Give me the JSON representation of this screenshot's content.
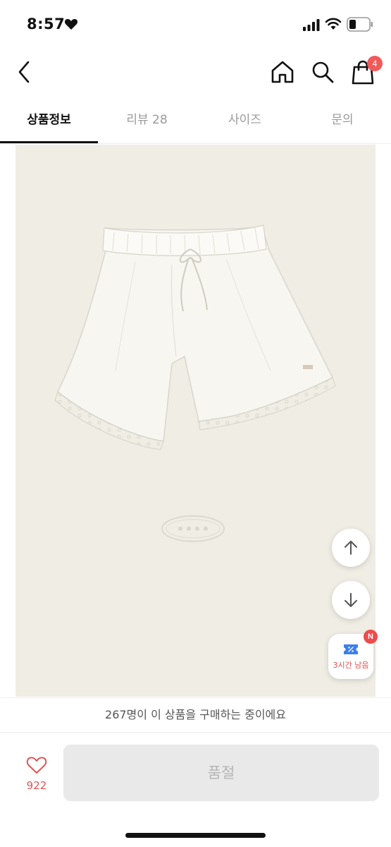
{
  "status_bar": {
    "time": "8:57",
    "icons": [
      "heart-icon",
      "signal-icon",
      "wifi-icon",
      "battery-icon"
    ]
  },
  "header": {
    "icons": [
      "back-icon",
      "home-icon",
      "search-icon",
      "shopping-bag-icon"
    ],
    "cart_count": "4"
  },
  "tabs": [
    {
      "label": "상품정보",
      "active": true
    },
    {
      "label": "리뷰 28",
      "active": false
    },
    {
      "label": "사이즈",
      "active": false
    },
    {
      "label": "문의",
      "active": false
    }
  ],
  "floating": {
    "scroll_up_icon": "arrow-up-icon",
    "scroll_down_icon": "arrow-down-icon",
    "coupon_label": "3시간 남음",
    "coupon_badge": "N"
  },
  "purchase_banner": "267명이 이 상품을 구매하는 중이에요",
  "bottom_bar": {
    "like_count": "922",
    "soldout_label": "품절"
  },
  "colors": {
    "accent_red": "#f05a5a",
    "image_background": "#efede4",
    "disabled_button": "#e9e9e9"
  }
}
